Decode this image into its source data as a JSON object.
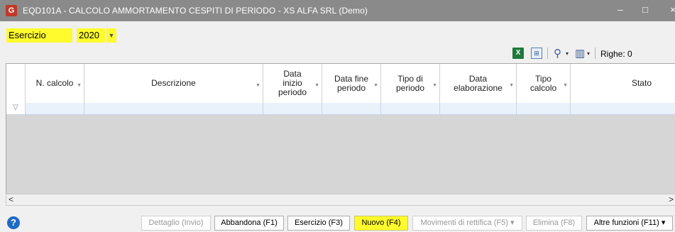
{
  "window": {
    "app_icon": "app-logo-icon",
    "title": "EQD101A - CALCOLO AMMORTAMENTO CESPITI DI PERIODO - XS ALFA SRL  (Demo)",
    "minimize": "–",
    "maximize": "□",
    "close": "×"
  },
  "esercizio": {
    "label": "Esercizio",
    "value": "2020",
    "dropdown_glyph": "▼"
  },
  "toolbar": {
    "excel_icon_text": "X",
    "grid_icon_text": "⊞",
    "search_glyph": "⚲",
    "columns_glyph": "▥",
    "dropdown_glyph": "▾",
    "righe_label": "Righe: 0"
  },
  "grid": {
    "columns": [
      {
        "label": "N. calcolo"
      },
      {
        "label": "Descrizione"
      },
      {
        "label": "Data inizio periodo"
      },
      {
        "label": "Data fine periodo"
      },
      {
        "label": "Tipo di periodo"
      },
      {
        "label": "Data elaborazione"
      },
      {
        "label": "Tipo calcolo"
      },
      {
        "label": "Stato"
      }
    ],
    "rows": [],
    "filter_icon_glyph": "▽",
    "sort_arrow_glyph": "▼"
  },
  "scroll": {
    "left": "<",
    "right": ">"
  },
  "footer": {
    "help_glyph": "?",
    "buttons": {
      "dettaglio": "Dettaglio (Invio)",
      "abbandona": "Abbandona (F1)",
      "esercizio": "Esercizio (F3)",
      "nuovo": "Nuovo (F4)",
      "movimenti": "Movimenti di rettifica (F5) ▾",
      "elimina": "Elimina (F8)",
      "altre": "Altre funzioni (F11) ▾"
    }
  },
  "colors": {
    "highlight": "#fffb2c",
    "titlebar": "#8a8a8a",
    "help": "#1e6bc6"
  }
}
